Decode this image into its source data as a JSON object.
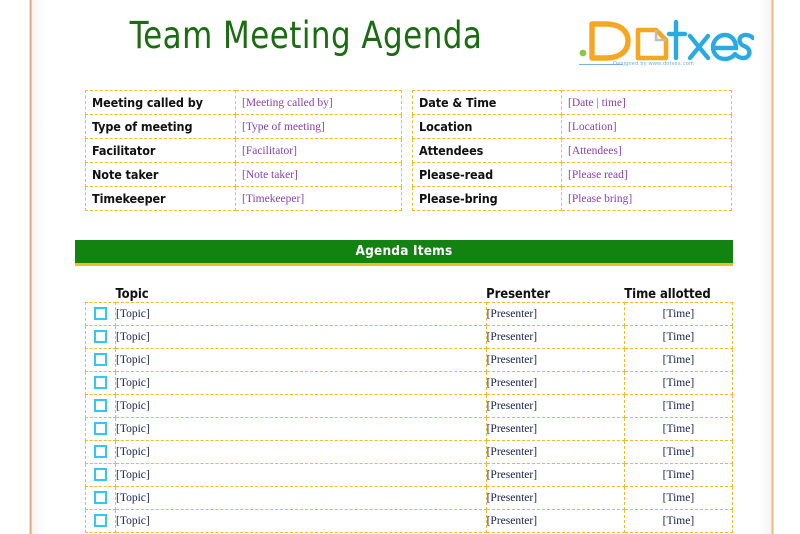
{
  "document": {
    "title": "Team Meeting Agenda",
    "title_color": "#1b6b12"
  },
  "logo": {
    "brand": ".Dotxes",
    "tagline": "Designed by www.dotxes.com",
    "color_orange": "#f5a623",
    "color_blue": "#29abe2"
  },
  "info_left": {
    "rows": [
      {
        "label": "Meeting called by",
        "value": "[Meeting called by]"
      },
      {
        "label": "Type of meeting",
        "value": "[Type of meeting]"
      },
      {
        "label": "Facilitator",
        "value": "[Facilitator]"
      },
      {
        "label": "Note taker",
        "value": "[Note taker]"
      },
      {
        "label": "Timekeeper",
        "value": "[Timekeeper]"
      }
    ]
  },
  "info_right": {
    "rows": [
      {
        "label": "Date & Time",
        "value": "[Date | time]"
      },
      {
        "label": "Location",
        "value": "[Location]"
      },
      {
        "label": "Attendees",
        "value": "[Attendees]"
      },
      {
        "label": "Please-read",
        "value": "[Please read]"
      },
      {
        "label": "Please-bring",
        "value": "[Please bring]"
      }
    ]
  },
  "agenda": {
    "banner_label": "Agenda Items",
    "banner_color": "#128211",
    "accent_border_color": "#f0bc2c",
    "checkbox_color": "#35c6f4",
    "headers": {
      "topic": "Topic",
      "presenter": "Presenter",
      "time": "Time allotted"
    },
    "rows": [
      {
        "checkbox": "unchecked",
        "topic": "[Topic]",
        "presenter": "[Presenter]",
        "time": "[Time]"
      },
      {
        "checkbox": "unchecked",
        "topic": "[Topic]",
        "presenter": "[Presenter]",
        "time": "[Time]"
      },
      {
        "checkbox": "unchecked",
        "topic": "[Topic]",
        "presenter": "[Presenter]",
        "time": "[Time]"
      },
      {
        "checkbox": "unchecked",
        "topic": "[Topic]",
        "presenter": "[Presenter]",
        "time": "[Time]"
      },
      {
        "checkbox": "unchecked",
        "topic": "[Topic]",
        "presenter": "[Presenter]",
        "time": "[Time]"
      },
      {
        "checkbox": "unchecked",
        "topic": "[Topic]",
        "presenter": "[Presenter]",
        "time": "[Time]"
      },
      {
        "checkbox": "unchecked",
        "topic": "[Topic]",
        "presenter": "[Presenter]",
        "time": "[Time]"
      },
      {
        "checkbox": "unchecked",
        "topic": "[Topic]",
        "presenter": "[Presenter]",
        "time": "[Time]"
      },
      {
        "checkbox": "unchecked",
        "topic": "[Topic]",
        "presenter": "[Presenter]",
        "time": "[Time]"
      },
      {
        "checkbox": "unchecked",
        "topic": "[Topic]",
        "presenter": "[Presenter]",
        "time": "[Time]"
      }
    ]
  }
}
